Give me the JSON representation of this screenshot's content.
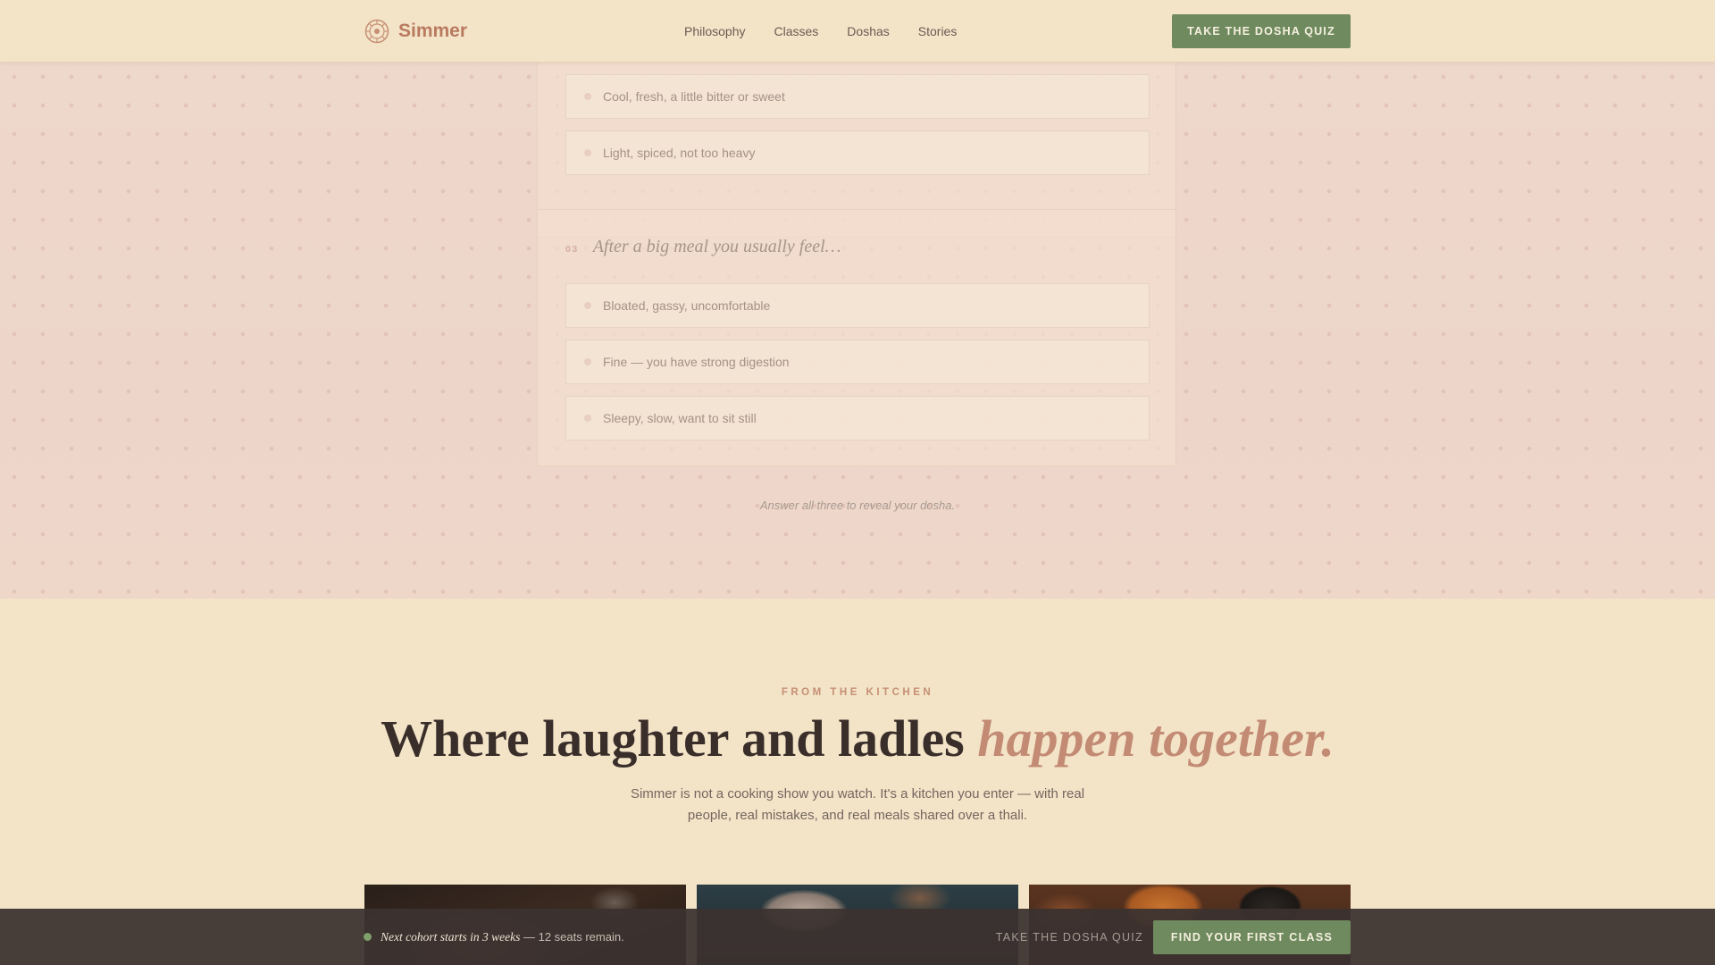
{
  "header": {
    "brand_name": "Simmer",
    "nav": [
      "Philosophy",
      "Classes",
      "Doshas",
      "Stories"
    ],
    "cta_label": "TAKE THE DOSHA QUIZ"
  },
  "quiz": {
    "previous_options": [
      "Cool, fresh, a little bitter or sweet",
      "Light, spiced, not too heavy"
    ],
    "question_3": {
      "number": "03",
      "title": "After a big meal you usually feel…",
      "options": [
        "Bloated, gassy, uncomfortable",
        "Fine — you have strong digestion",
        "Sleepy, slow, want to sit still"
      ]
    },
    "note": "Answer all three to reveal your dosha."
  },
  "kitchen": {
    "eyebrow": "FROM THE KITCHEN",
    "headline_main": "Where laughter and ladles ",
    "headline_accent": "happen together.",
    "lede": "Simmer is not a cooking show you watch. It's a kitchen you enter — with real people, real mistakes, and real meals shared over a thali."
  },
  "sticky_bar": {
    "cohort_lead": "Next cohort starts in 3 weeks",
    "cohort_rest": " — 12 seats remain.",
    "link_label": "TAKE THE DOSHA QUIZ",
    "cta_label": "FIND YOUR FIRST CLASS"
  },
  "colors": {
    "accent_green": "#6f8a5e",
    "accent_terracotta": "#c38a74",
    "cream_background": "#f3e4c8",
    "quiz_background": "#eed7cb",
    "sticky_bar": "#3c3230"
  }
}
